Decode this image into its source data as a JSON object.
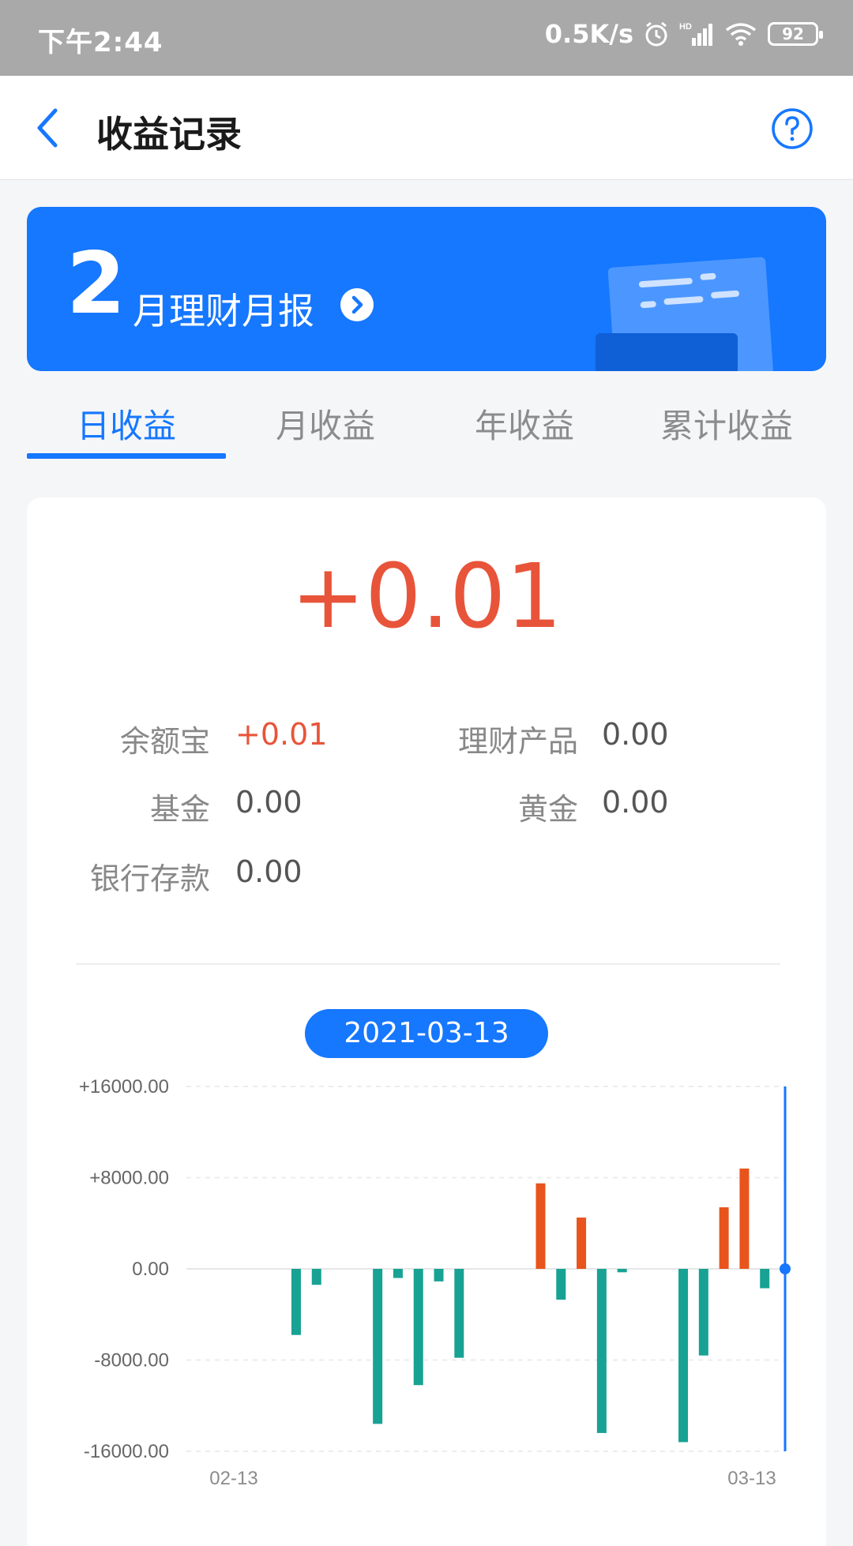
{
  "status_bar": {
    "time": "下午2:44",
    "net_speed": "0.5K/s",
    "hd_label": "HD",
    "battery": "92",
    "icons": [
      "alarm-icon",
      "signal-icon",
      "wifi-icon",
      "battery-icon"
    ]
  },
  "header": {
    "title": "收益记录",
    "back_icon": "chevron-left-icon",
    "help_icon": "help-circle-icon"
  },
  "banner": {
    "month": "2",
    "label": "月理财月报",
    "arrow_icon": "chevron-right-circle-icon"
  },
  "tabs": [
    {
      "label": "日收益",
      "active": true
    },
    {
      "label": "月收益",
      "active": false
    },
    {
      "label": "年收益",
      "active": false
    },
    {
      "label": "累计收益",
      "active": false
    }
  ],
  "summary": {
    "total": "+0.01",
    "items": [
      {
        "key": "余额宝",
        "value": "+0.01",
        "positive": true
      },
      {
        "key": "理财产品",
        "value": "0.00",
        "positive": false
      },
      {
        "key": "基金",
        "value": "0.00",
        "positive": false
      },
      {
        "key": "黄金",
        "value": "0.00",
        "positive": false
      },
      {
        "key": "银行存款",
        "value": "0.00",
        "positive": false
      }
    ]
  },
  "selected_date": "2021-03-13",
  "colors": {
    "accent": "#1677ff",
    "positive": "#e8541c",
    "negative": "#17a294"
  },
  "chart_data": {
    "type": "bar",
    "x_start_label": "02-13",
    "x_end_label": "03-13",
    "y_tick_labels": [
      "+16000.00",
      "+8000.00",
      "0.00",
      "-8000.00",
      "-16000.00"
    ],
    "ylim": [
      -16000,
      16000
    ],
    "grid": true,
    "values": [
      0,
      0,
      0,
      0,
      0,
      -5800,
      -1400,
      0,
      0,
      -13600,
      -800,
      -10200,
      -1100,
      -7800,
      0,
      0,
      0,
      7500,
      -2700,
      4500,
      -14400,
      -300,
      0,
      0,
      -15200,
      -7600,
      5400,
      8800,
      -1700,
      0.01
    ],
    "selected_index": 29
  }
}
